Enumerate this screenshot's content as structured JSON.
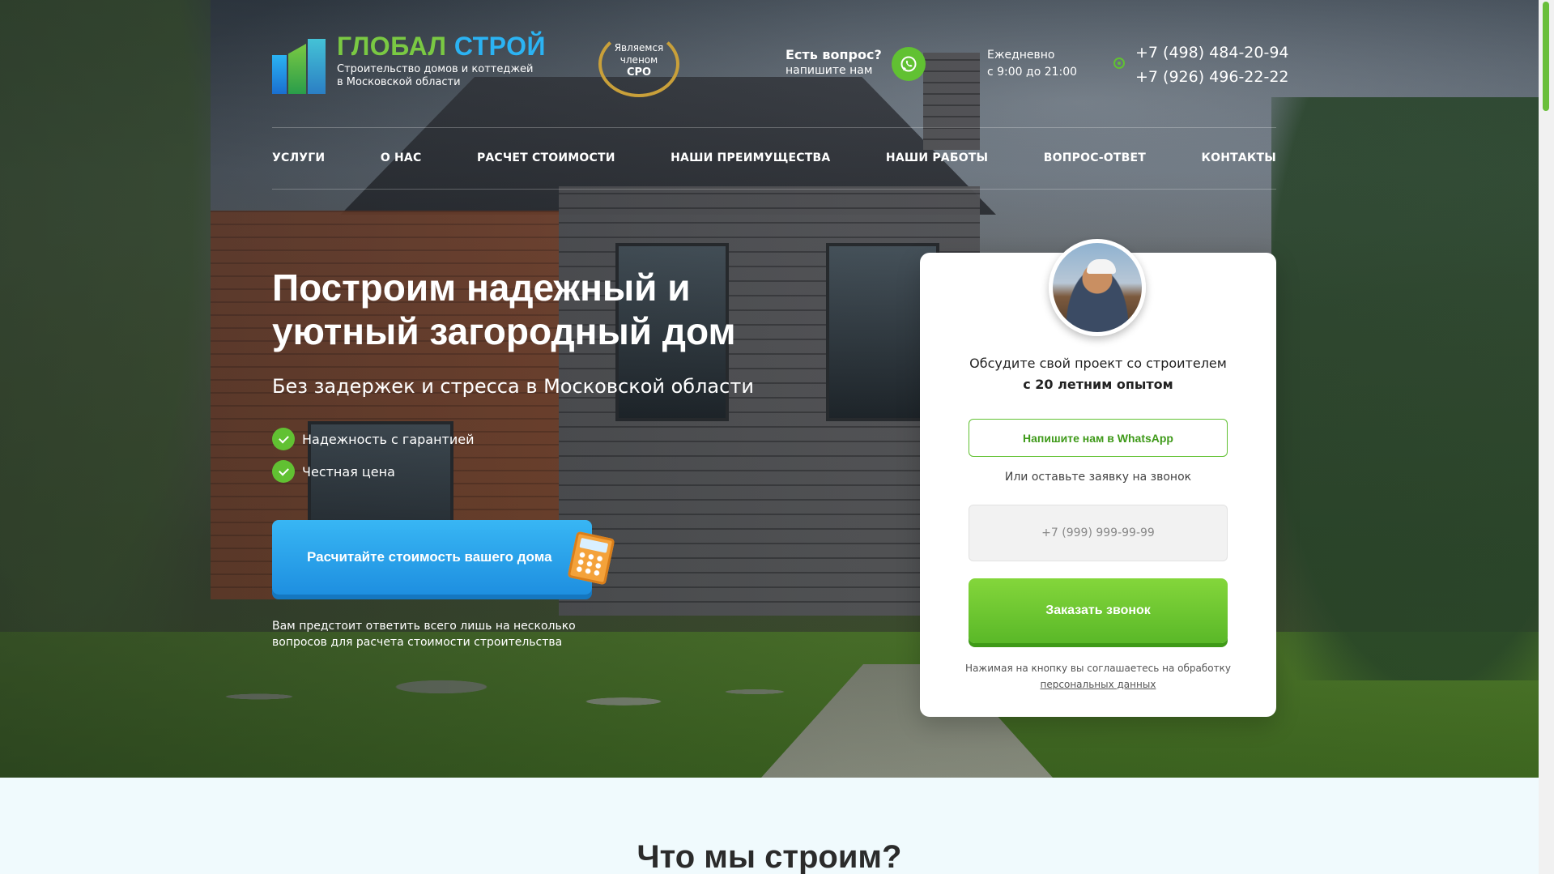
{
  "header": {
    "logo_title_green": "ГЛОБАЛ",
    "logo_title_blue": "СТРОЙ",
    "logo_sub_line1": "Строительство домов и коттеджей",
    "logo_sub_line2": "в Московской области",
    "badge_line1": "Являемся",
    "badge_line2": "членом",
    "badge_line3": "СРО",
    "ask_title": "Есть вопрос?",
    "ask_sub": "напишите нам",
    "hours_line1": "Ежедневно",
    "hours_line2": "с 9:00 до 21:00",
    "phone1": "+7 (498) 484-20-94",
    "phone2": "+7 (926) 496-22-22"
  },
  "nav": {
    "items": [
      "УСЛУГИ",
      "О НАС",
      "РАСЧЕТ СТОИМОСТИ",
      "НАШИ ПРЕИМУЩЕСТВА",
      "НАШИ РАБОТЫ",
      "ВОПРОС-ОТВЕТ",
      "КОНТАКТЫ"
    ]
  },
  "hero": {
    "title_line1": "Построим надежный и",
    "title_line2": "уютный загородный дом",
    "subtitle": "Без задержек и стресса в Московской области",
    "features": [
      "Надежность с гарантией",
      "Честная цена"
    ],
    "calc_button": "Расчитайте стоимость вашего дома",
    "calc_note_line1": "Вам предстоит ответить всего лишь на несколько",
    "calc_note_line2": "вопросов для расчета стоимости строительства"
  },
  "form": {
    "intro_line1": "Обсудите свой проект со строителем",
    "intro_line2": "с 20 летним опытом",
    "whatsapp_button": "Напишите нам в WhatsApp",
    "or_text": "Или оставьте заявку на звонок",
    "phone_placeholder": "+7 (999) 999-99-99",
    "order_button": "Заказать звонок",
    "consent_text": "Нажимая на кнопку вы соглашаетесь на обработку",
    "consent_link": "персональных данных"
  },
  "section": {
    "title": "Что мы строим?"
  },
  "colors": {
    "green": "#61c132",
    "blue": "#2bb3f3"
  }
}
